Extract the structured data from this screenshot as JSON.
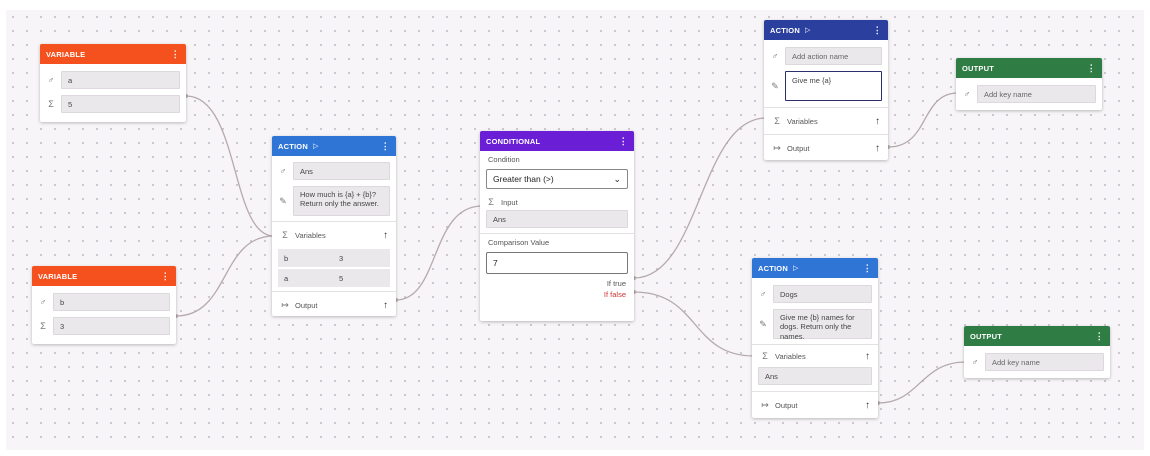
{
  "colors": {
    "variable": "#f4511e",
    "action_light": "#2f75d6",
    "action_dark": "#2a3f9e",
    "conditional": "#6a1fd6",
    "output": "#2f7d45",
    "if_false": "#cc3333"
  },
  "icons": {
    "name": "key-icon",
    "value": "sigma-icon",
    "prompt": "pencil-icon",
    "output": "output-arrow-icon",
    "collapse": "arrow-up-icon",
    "run": "play-icon",
    "menu": "kebab-menu-icon",
    "dropdown": "chevron-down-icon"
  },
  "var_a": {
    "title": "VARIABLE",
    "name": "a",
    "value": "5"
  },
  "var_b": {
    "title": "VARIABLE",
    "name": "b",
    "value": "3"
  },
  "action1": {
    "title": "ACTION",
    "name": "Ans",
    "prompt": "How much is {a} + {b}? Return only the answer.",
    "variables_label": "Variables",
    "variables": [
      {
        "key": "b",
        "value": "3"
      },
      {
        "key": "a",
        "value": "5"
      }
    ],
    "output_label": "Output"
  },
  "conditional": {
    "title": "CONDITIONAL",
    "condition_label": "Condition",
    "condition_value": "Greater than (>)",
    "input_label": "Input",
    "input_value": "Ans",
    "comparison_label": "Comparison Value",
    "comparison_value": "7",
    "if_true": "If true",
    "if_false": "If false"
  },
  "action2": {
    "title": "ACTION",
    "name_placeholder": "Add action name",
    "prompt": "Give me {a}",
    "variables_label": "Variables",
    "output_label": "Output"
  },
  "action3": {
    "title": "ACTION",
    "name": "Dogs",
    "prompt": "Give me {b} names for dogs. Return only the names.",
    "variables_label": "Variables",
    "variable_value": "Ans",
    "output_label": "Output"
  },
  "output1": {
    "title": "OUTPUT",
    "key_placeholder": "Add key name"
  },
  "output2": {
    "title": "OUTPUT",
    "key_placeholder": "Add key name"
  }
}
